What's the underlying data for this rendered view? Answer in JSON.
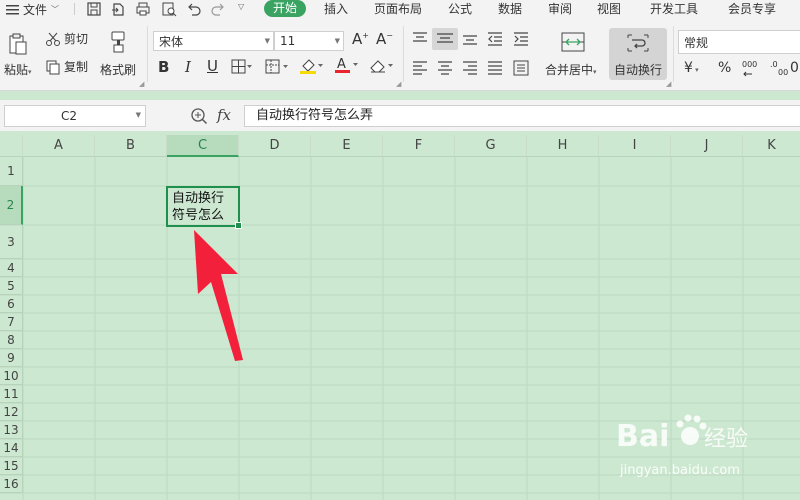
{
  "menubar": {
    "file_label": "文件",
    "tabs": [
      {
        "label": "开始",
        "active": true
      },
      {
        "label": "插入"
      },
      {
        "label": "页面布局"
      },
      {
        "label": "公式"
      },
      {
        "label": "数据"
      },
      {
        "label": "审阅"
      },
      {
        "label": "视图"
      },
      {
        "label": "开发工具"
      },
      {
        "label": "会员专享"
      }
    ]
  },
  "ribbon": {
    "clipboard": {
      "paste": "粘贴",
      "cut": "剪切",
      "copy": "复制",
      "format_painter": "格式刷"
    },
    "font": {
      "name": "宋体",
      "size": "11"
    },
    "merge_center": "合并居中",
    "wrap_text": "自动换行",
    "number_format": "常规",
    "currency_symbol": "¥",
    "percent_symbol": "%"
  },
  "formula_bar": {
    "name_box": "C2",
    "fx": "fx",
    "content": "自动换行符号怎么弄"
  },
  "sheet": {
    "columns": [
      "A",
      "B",
      "C",
      "D",
      "E",
      "F",
      "G",
      "H",
      "I",
      "J",
      "K"
    ],
    "rows": [
      "1",
      "2",
      "3",
      "4",
      "5",
      "6",
      "7",
      "8",
      "9",
      "10",
      "11",
      "12",
      "13",
      "14",
      "15",
      "16"
    ],
    "selected_cell": {
      "line1": "自动换行",
      "line2": "符号怎么"
    }
  },
  "watermark": {
    "brand": "Bai",
    "brand_cn": "经验",
    "url": "jingyan.baidu.com"
  },
  "colors": {
    "accent": "#3aa362",
    "sheet_bg": "#cde8d1",
    "arrow": "#f2203a"
  }
}
